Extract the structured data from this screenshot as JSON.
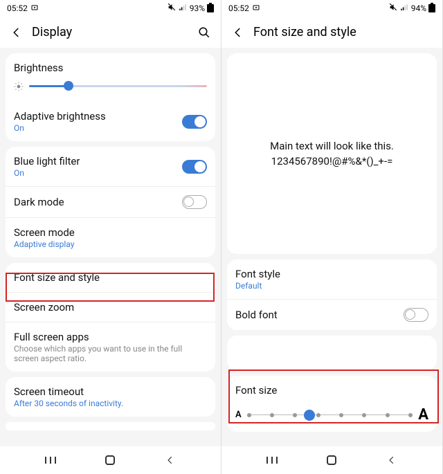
{
  "left": {
    "status": {
      "time": "05:52",
      "battery": "93%"
    },
    "header": {
      "title": "Display"
    },
    "brightness": {
      "label": "Brightness"
    },
    "adaptive": {
      "title": "Adaptive brightness",
      "sub": "On"
    },
    "bluelight": {
      "title": "Blue light filter",
      "sub": "On"
    },
    "darkmode": {
      "title": "Dark mode"
    },
    "screenmode": {
      "title": "Screen mode",
      "sub": "Adaptive display"
    },
    "fontsize": {
      "title": "Font size and style"
    },
    "screenzoom": {
      "title": "Screen zoom"
    },
    "fullscreen": {
      "title": "Full screen apps",
      "sub": "Choose which apps you want to use in the full screen aspect ratio."
    },
    "timeout": {
      "title": "Screen timeout",
      "sub": "After 30 seconds of inactivity."
    }
  },
  "right": {
    "status": {
      "time": "05:52",
      "battery": "94%"
    },
    "header": {
      "title": "Font size and style"
    },
    "preview": {
      "line1": "Main text will look like this.",
      "line2": "1234567890!@#%&*()_+-="
    },
    "fontstyle": {
      "title": "Font style",
      "sub": "Default"
    },
    "boldfont": {
      "title": "Bold font"
    },
    "fontsize": {
      "title": "Font size",
      "small": "A",
      "large": "A"
    }
  }
}
